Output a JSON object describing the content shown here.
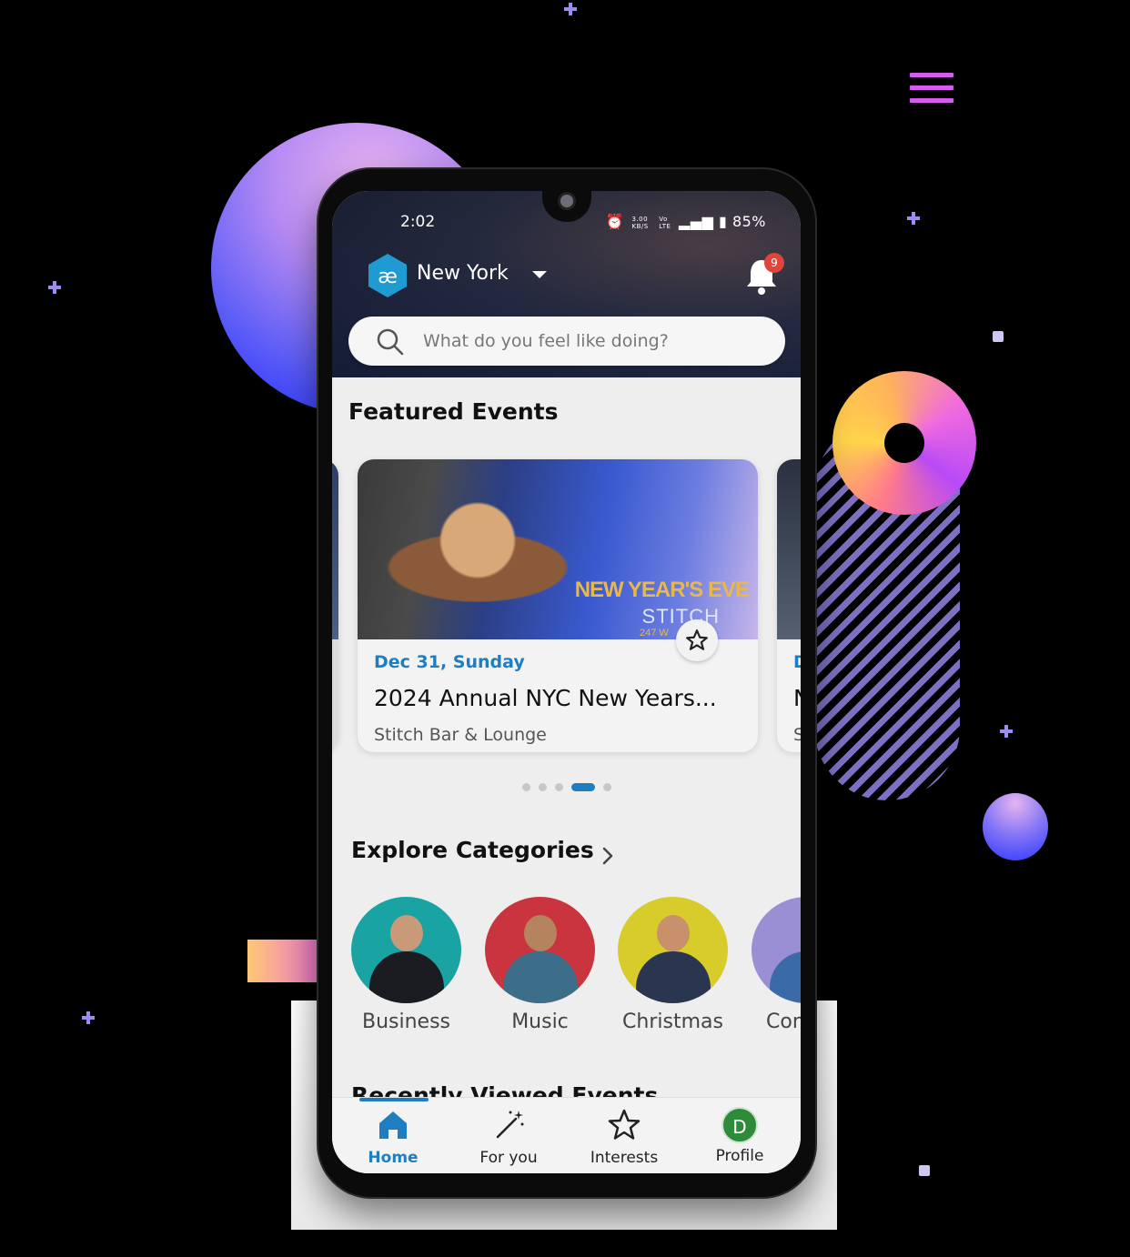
{
  "status_bar": {
    "time": "2:02",
    "net_speed_top": "3.00",
    "net_speed_unit": "KB/S",
    "vo": "Vo",
    "lte": "LTE",
    "battery": "85%"
  },
  "header": {
    "city": "New York",
    "notifications_count": "9"
  },
  "search": {
    "placeholder": "What do you feel like doing?"
  },
  "featured": {
    "title": "Featured Events",
    "cards": [
      {
        "image_text_1": "NEW YEAR'S EVE",
        "image_text_2": "STITCH",
        "image_text_3": "247 W",
        "date": "Dec 31, Sunday",
        "title": "2024 Annual NYC New Years...",
        "venue": "Stitch Bar & Lounge"
      },
      {
        "date": "D",
        "title": "N",
        "venue": "S"
      }
    ],
    "carousel_total": 5,
    "carousel_active": 4
  },
  "categories": {
    "title": "Explore Categories",
    "items": [
      {
        "label": "Business",
        "color": "#1aa3a3"
      },
      {
        "label": "Music",
        "color": "#c9343e"
      },
      {
        "label": "Christmas",
        "color": "#d7cc2a"
      },
      {
        "label": "Con",
        "color": "#9a8ed4"
      }
    ]
  },
  "recent": {
    "title": "Recently Viewed Events"
  },
  "bottom_nav": {
    "items": [
      {
        "label": "Home",
        "icon": "home-icon",
        "active": true
      },
      {
        "label": "For you",
        "icon": "magic-wand-icon"
      },
      {
        "label": "Interests",
        "icon": "star-icon"
      },
      {
        "label": "Profile",
        "icon": "avatar",
        "initial": "D"
      }
    ]
  },
  "colors": {
    "accent": "#1f7ec2",
    "badge": "#e0453c",
    "profile_avatar": "#2e8b3a"
  }
}
